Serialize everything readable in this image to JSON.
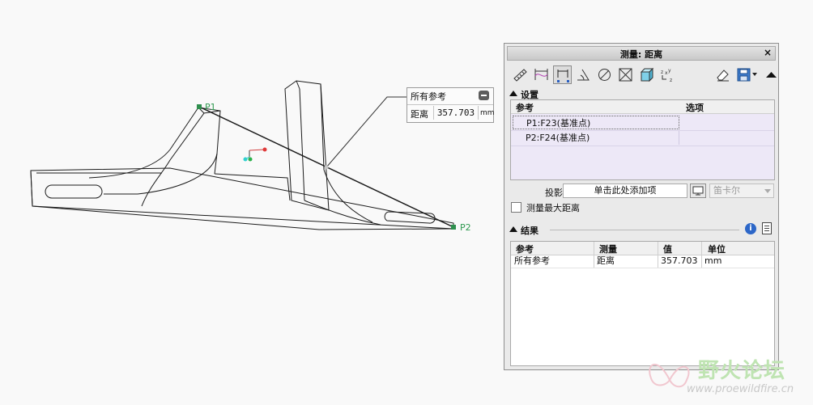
{
  "viewport": {
    "callout": {
      "title": "所有参考",
      "label": "距离",
      "value": "357.703",
      "unit": "mm"
    },
    "points": {
      "p1": "P1",
      "p2": "P2"
    }
  },
  "dialog": {
    "title": "测量: 距离",
    "close": "×",
    "toolbar": [
      "ruler-icon",
      "length-icon",
      "distance-icon",
      "angle-icon",
      "diameter-icon",
      "area-icon",
      "volume-icon",
      "transform-icon",
      "eraser-icon",
      "save-icon",
      "collapse-toolbar-icon"
    ],
    "settings": {
      "title": "设置",
      "columns": [
        "参考",
        "选项"
      ],
      "rows": [
        "P1:F23(基准点)",
        "P2:F24(基准点)"
      ],
      "projection_label": "投影:",
      "projection_value": "单击此处添加项",
      "coord_system": "笛卡尔",
      "max_distance_label": "测量最大距离",
      "max_distance_checked": false
    },
    "results": {
      "title": "结果",
      "columns": [
        "参考",
        "测量",
        "值",
        "单位"
      ],
      "rows": [
        {
          "ref": "所有参考",
          "measure": "距离",
          "value": "357.703",
          "unit": "mm"
        }
      ]
    }
  },
  "watermark": {
    "text": "野火论坛",
    "url": "www.proewildfire.cn"
  }
}
